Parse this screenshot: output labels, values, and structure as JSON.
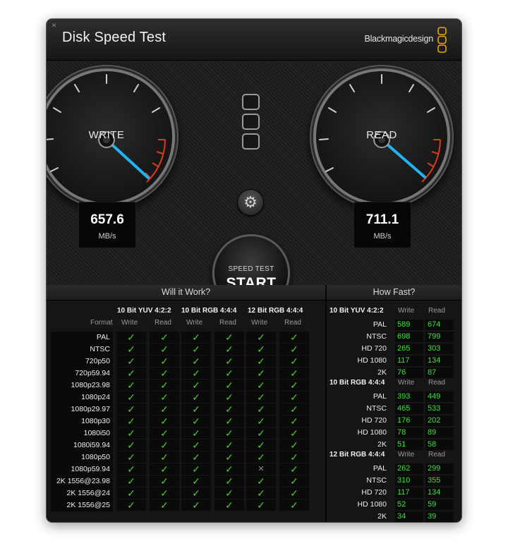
{
  "window": {
    "title": "Disk Speed Test",
    "brand": "Blackmagicdesign"
  },
  "gauges": {
    "write": {
      "label": "WRITE",
      "value": "657.6",
      "unit": "MB/s"
    },
    "read": {
      "label": "READ",
      "value": "711.1",
      "unit": "MB/s"
    }
  },
  "start_button": {
    "top": "SPEED TEST",
    "main": "START"
  },
  "will_it_work": {
    "title": "Will it Work?",
    "format_header": "Format",
    "groups": [
      "10 Bit YUV 4:2:2",
      "10 Bit RGB 4:4:4",
      "12 Bit RGB 4:4:4"
    ],
    "subheaders": [
      "Write",
      "Read",
      "Write",
      "Read",
      "Write",
      "Read"
    ],
    "rows": [
      {
        "format": "PAL",
        "results": [
          1,
          1,
          1,
          1,
          1,
          1
        ]
      },
      {
        "format": "NTSC",
        "results": [
          1,
          1,
          1,
          1,
          1,
          1
        ]
      },
      {
        "format": "720p50",
        "results": [
          1,
          1,
          1,
          1,
          1,
          1
        ]
      },
      {
        "format": "720p59.94",
        "results": [
          1,
          1,
          1,
          1,
          1,
          1
        ]
      },
      {
        "format": "1080p23.98",
        "results": [
          1,
          1,
          1,
          1,
          1,
          1
        ]
      },
      {
        "format": "1080p24",
        "results": [
          1,
          1,
          1,
          1,
          1,
          1
        ]
      },
      {
        "format": "1080p29.97",
        "results": [
          1,
          1,
          1,
          1,
          1,
          1
        ]
      },
      {
        "format": "1080p30",
        "results": [
          1,
          1,
          1,
          1,
          1,
          1
        ]
      },
      {
        "format": "1080i50",
        "results": [
          1,
          1,
          1,
          1,
          1,
          1
        ]
      },
      {
        "format": "1080i59.94",
        "results": [
          1,
          1,
          1,
          1,
          1,
          1
        ]
      },
      {
        "format": "1080p50",
        "results": [
          1,
          1,
          1,
          1,
          1,
          1
        ]
      },
      {
        "format": "1080p59.94",
        "results": [
          1,
          1,
          1,
          1,
          0,
          1
        ]
      },
      {
        "format": "2K 1556@23.98",
        "results": [
          1,
          1,
          1,
          1,
          1,
          1
        ]
      },
      {
        "format": "2K 1556@24",
        "results": [
          1,
          1,
          1,
          1,
          1,
          1
        ]
      },
      {
        "format": "2K 1556@25",
        "results": [
          1,
          1,
          1,
          1,
          1,
          1
        ]
      }
    ]
  },
  "how_fast": {
    "title": "How Fast?",
    "write_label": "Write",
    "read_label": "Read",
    "groups": [
      {
        "name": "10 Bit YUV 4:2:2",
        "rows": [
          {
            "format": "PAL",
            "write": "589",
            "read": "674"
          },
          {
            "format": "NTSC",
            "write": "698",
            "read": "799"
          },
          {
            "format": "HD 720",
            "write": "265",
            "read": "303"
          },
          {
            "format": "HD 1080",
            "write": "117",
            "read": "134"
          },
          {
            "format": "2K",
            "write": "76",
            "read": "87"
          }
        ]
      },
      {
        "name": "10 Bit RGB 4:4:4",
        "rows": [
          {
            "format": "PAL",
            "write": "393",
            "read": "449"
          },
          {
            "format": "NTSC",
            "write": "465",
            "read": "533"
          },
          {
            "format": "HD 720",
            "write": "176",
            "read": "202"
          },
          {
            "format": "HD 1080",
            "write": "78",
            "read": "89"
          },
          {
            "format": "2K",
            "write": "51",
            "read": "58"
          }
        ]
      },
      {
        "name": "12 Bit RGB 4:4:4",
        "rows": [
          {
            "format": "PAL",
            "write": "262",
            "read": "299"
          },
          {
            "format": "NTSC",
            "write": "310",
            "read": "355"
          },
          {
            "format": "HD 720",
            "write": "117",
            "read": "134"
          },
          {
            "format": "HD 1080",
            "write": "52",
            "read": "59"
          },
          {
            "format": "2K",
            "write": "34",
            "read": "39"
          }
        ]
      }
    ]
  },
  "colors": {
    "accent_needle": "#1fb4f2",
    "ok": "#4ec72f",
    "value_green": "#39e336"
  },
  "icons": {
    "close": "close-icon",
    "gear": "gear-icon",
    "logo": "blackmagic-logo-icon"
  }
}
